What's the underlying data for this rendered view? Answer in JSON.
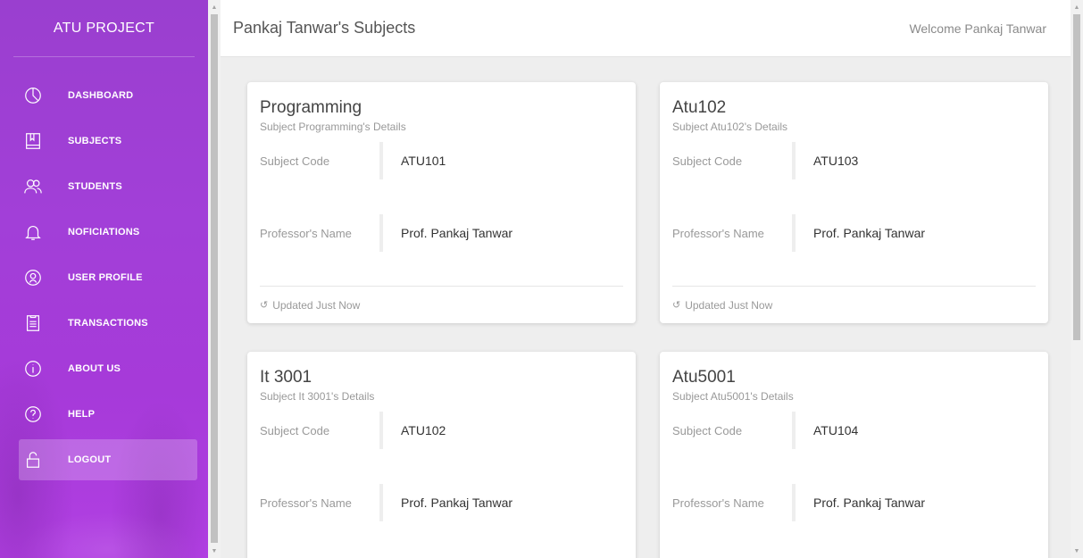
{
  "sidebar": {
    "brand": "ATU PROJECT",
    "items": [
      {
        "label": "DASHBOARD",
        "icon": "pie-chart-icon"
      },
      {
        "label": "SUBJECTS",
        "icon": "book-icon"
      },
      {
        "label": "STUDENTS",
        "icon": "users-icon"
      },
      {
        "label": "NOFICIATIONS",
        "icon": "bell-icon"
      },
      {
        "label": "USER PROFILE",
        "icon": "user-circle-icon"
      },
      {
        "label": "TRANSACTIONS",
        "icon": "clipboard-icon"
      },
      {
        "label": "ABOUT US",
        "icon": "info-icon"
      },
      {
        "label": "HELP",
        "icon": "help-icon"
      },
      {
        "label": "LOGOUT",
        "icon": "lock-icon"
      }
    ],
    "active_item": "LOGOUT"
  },
  "header": {
    "title": "Pankaj Tanwar's Subjects",
    "welcome": "Welcome Pankaj Tanwar"
  },
  "labels": {
    "subject_code": "Subject Code",
    "professor_name": "Professor's Name",
    "updated": "Updated Just Now"
  },
  "subjects": [
    {
      "title": "Programming",
      "subtitle": "Subject Programming's Details",
      "code": "ATU101",
      "professor": "Prof. Pankaj Tanwar"
    },
    {
      "title": "Atu102",
      "subtitle": "Subject Atu102's Details",
      "code": "ATU103",
      "professor": "Prof. Pankaj Tanwar"
    },
    {
      "title": "It 3001",
      "subtitle": "Subject It 3001's Details",
      "code": "ATU102",
      "professor": "Prof. Pankaj Tanwar"
    },
    {
      "title": "Atu5001",
      "subtitle": "Subject Atu5001's Details",
      "code": "ATU104",
      "professor": "Prof. Pankaj Tanwar"
    }
  ],
  "colors": {
    "sidebar_top": "#9a3fcf",
    "sidebar_bottom": "#b13fe2",
    "background": "#eeeeee"
  }
}
